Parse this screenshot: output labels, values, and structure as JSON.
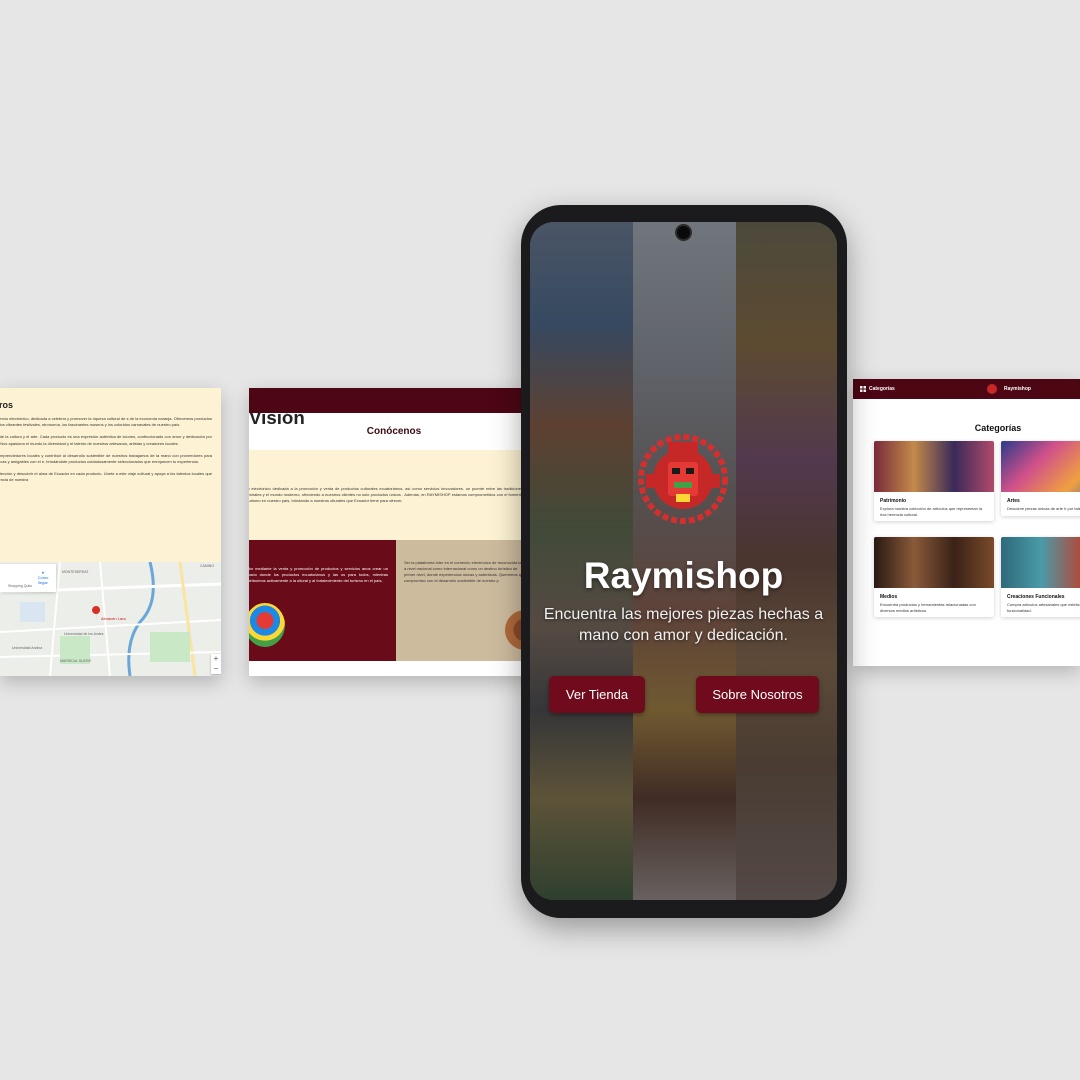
{
  "about_card": {
    "title": "osotros",
    "paragraphs": [
      "uestra tienda de comercio electrónico, dedicada a celebrar y promover la riqueza cultural de s de la economía naranja. Ofrecemos productos únicos inspirados en los vibrantes festivales, stronomía, los fascinantes museos y los coloridos carnavales de nuestro país.",
      "poder transformador de la cultura y el arte. Cada producto es una expresión auténtica de iciones, confeccionado con amor y dedicación por manos ecuatorianas. Nos apasiona el mundo la diversidad y el talento de nuestros artesanos, artistas y creadores locales.",
      "os en apoyar a los emprendedores locales y contribuir al desarrollo sostenible de nuestros trabajamos de la mano con proveedores para asegurar prácticas éticas y amigables con el e, brindándote productos cuidadosamente seleccionados que enriquecen tu experiencia.",
      "a explorar nuestra colección y descubrir el alma de Ecuador en cada producto. Únete a este viaje cultural y apoya a los talentos locales que mantienen viva la esencia de nuestra"
    ],
    "map": {
      "directions_label": "Cómo llegar",
      "pin_label": "Almacén Lara",
      "streets": [
        "MONTESERRAT",
        "PASAJE 16",
        "CAMINO",
        "Shopping Quito",
        "Coliseo",
        "Universidad de los Andes",
        "Universidad Andina",
        "MARISCAL SUCRE"
      ],
      "zoom_in": "+",
      "zoom_out": "−"
    }
  },
  "know_card": {
    "title": "Conócenos",
    "intro": "ercio electrónico dedicada a la promoción y venta de productos culturales ecuatorianos, así como servicios innovadores. un puente entre las tradiciones ancestrales y el mundo moderno, ofreciendo a nuestros clientes no solo productos únicos . Además, en RAYMISHOP estamos comprometidos con el fomento del turismo en nuestro país, brindando a nuestros ulturales que Ecuador tiene para ofrecer.",
    "mision_text": "uador mediante la venta y promoción de productos y servicios anos crear un espacio donde los productos ecuatorianos y las os para todos, mientras contribuimos activamente a la ultural y al fortalecimiento del turismo en el país.",
    "vision_title": "Visión",
    "vision_text": "Ser la plataforma líder en el comercio electrónico de reconocida tanto a nivel nacional como internacional como un destino turístico de primer nivel, donde experiencias únicas y auténticas. Queremos que compromiso con el desarrollo sostenible de nuestro p"
  },
  "categories_card": {
    "nav_label": "Categorías",
    "brand": "Raymishop",
    "title": "Categorías",
    "items": [
      {
        "name": "Patrimonio",
        "desc": "Explora nuestra colección de artículos que representan la rica herencia cultural."
      },
      {
        "name": "Artes",
        "desc": "Descubre piezas únicas de arte h por talentosos artesanos."
      },
      {
        "name": "Medios",
        "desc": "Encuentra productos y herramientas relacionadas con diversos medios artísticos."
      },
      {
        "name": "Creaciones Funcionales",
        "desc": "Compra artículos artesanales que estético con funcionalidad."
      }
    ]
  },
  "phone": {
    "title": "Raymishop",
    "subtitle": "Encuentra las mejores piezas hechas a mano con amor y dedicación.",
    "btn_shop": "Ver Tienda",
    "btn_about": "Sobre Nosotros"
  },
  "colors": {
    "maroon": "#6f0b1c",
    "dark_maroon": "#4c0614",
    "cream": "#fdf2d3",
    "beige": "#cdbb9e",
    "background": "#e6e6e7"
  }
}
